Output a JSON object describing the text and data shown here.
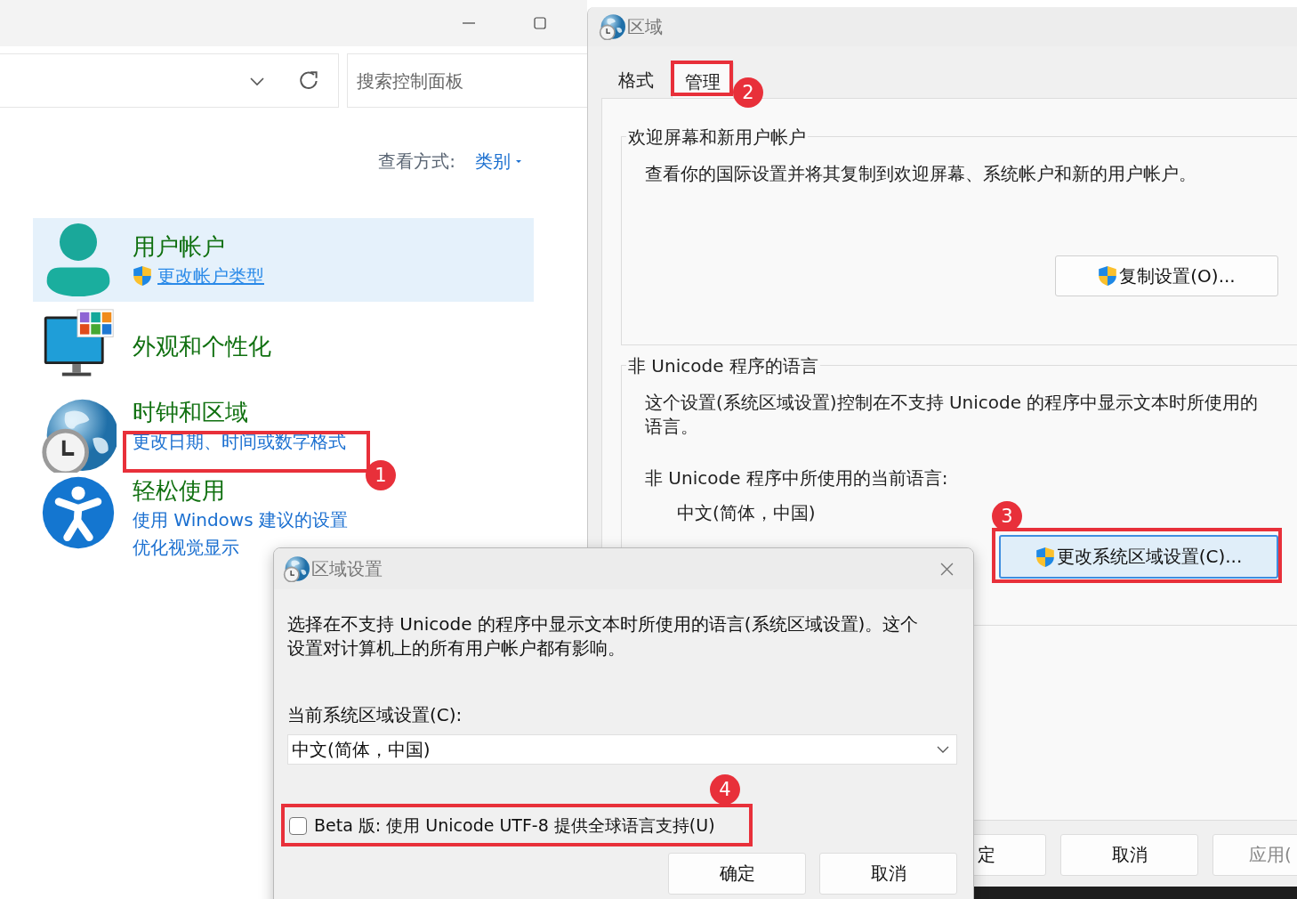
{
  "control_panel": {
    "search": {
      "placeholder": "搜索控制面板"
    },
    "view_by": {
      "label": "查看方式:",
      "value": "类别"
    },
    "categories": [
      {
        "title": "用户帐户",
        "selected": true,
        "links": [
          {
            "text": "更改帐户类型",
            "shield": true,
            "hovered": true
          }
        ]
      },
      {
        "title": "外观和个性化",
        "selected": false
      },
      {
        "title": "时钟和区域",
        "selected": false,
        "links": [
          {
            "text": "更改日期、时间或数字格式",
            "shield": false,
            "hovered": false
          }
        ]
      },
      {
        "title": "轻松使用",
        "selected": false,
        "links": [
          {
            "text": "使用 Windows 建议的设置",
            "shield": false,
            "hovered": false
          },
          {
            "text": "优化视觉显示",
            "shield": false,
            "hovered": false
          }
        ]
      }
    ]
  },
  "region_window": {
    "title": "区域",
    "tabs": [
      {
        "label": "格式",
        "selected": false
      },
      {
        "label": "管理",
        "selected": true
      }
    ],
    "groups": [
      {
        "title": "欢迎屏幕和新用户帐户",
        "lines": [
          {
            "kind": "text",
            "text": "查看你的国际设置并将其复制到欢迎屏幕、系统帐户和新的用户帐户。"
          }
        ],
        "button": {
          "label": "复制设置(O)...",
          "shield": true,
          "focused": false
        }
      },
      {
        "title": "非 Unicode 程序的语言",
        "lines": [
          {
            "kind": "text",
            "text": "这个设置(系统区域设置)控制在不支持 Unicode 的程序中显示文本时所使用的语言。"
          },
          {
            "kind": "text",
            "text": "非 Unicode 程序中所使用的当前语言:"
          },
          {
            "kind": "value",
            "text": "中文(简体，中国)"
          }
        ],
        "button": {
          "label": "更改系统区域设置(C)...",
          "shield": true,
          "focused": true
        }
      }
    ],
    "buttons": [
      {
        "label": "定",
        "disabled": false
      },
      {
        "label": "取消",
        "disabled": false
      },
      {
        "label": "应用(",
        "disabled": true
      }
    ]
  },
  "dialog": {
    "title": "区域设置",
    "description": "选择在不支持 Unicode 的程序中显示文本时所使用的语言(系统区域设置)。这个设置对计算机上的所有用户帐户都有影响。",
    "locale_label": "当前系统区域设置(C):",
    "locale_value": "中文(简体，中国)",
    "beta_option": {
      "label": "Beta 版: 使用 Unicode UTF-8 提供全球语言支持(U)",
      "checked": false
    },
    "buttons": [
      {
        "label": "确定"
      },
      {
        "label": "取消"
      }
    ]
  },
  "annotations": [
    {
      "number": "1"
    },
    {
      "number": "2"
    },
    {
      "number": "3"
    },
    {
      "number": "4"
    }
  ]
}
